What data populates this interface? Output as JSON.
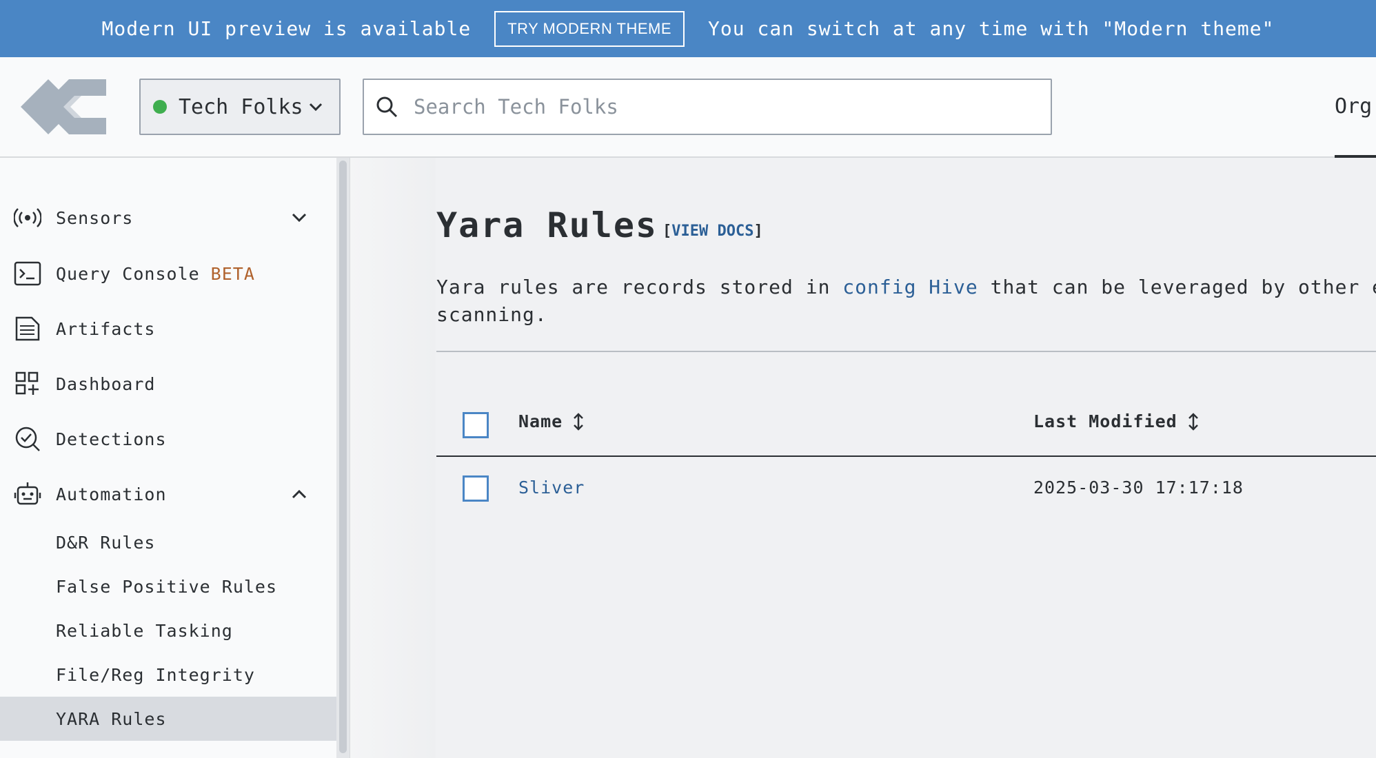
{
  "banner": {
    "message": "Modern UI preview is available",
    "button_label": "TRY MODERN THEME",
    "note": "You can switch at any time with \"Modern theme\""
  },
  "header": {
    "org_name": "Tech Folks",
    "org_status_color": "#3fae4f",
    "search_placeholder": "Search Tech Folks",
    "right_tab": "Org"
  },
  "sidebar": {
    "items": [
      {
        "label": "Sensors",
        "icon": "broadcast-icon",
        "expanded": false
      },
      {
        "label": "Query Console",
        "badge": "BETA",
        "icon": "terminal-icon"
      },
      {
        "label": "Artifacts",
        "icon": "document-icon"
      },
      {
        "label": "Dashboard",
        "icon": "dashboard-icon"
      },
      {
        "label": "Detections",
        "icon": "detections-icon"
      },
      {
        "label": "Automation",
        "icon": "robot-icon",
        "expanded": true
      }
    ],
    "automation_children": [
      {
        "label": "D&R Rules"
      },
      {
        "label": "False Positive Rules"
      },
      {
        "label": "Reliable Tasking"
      },
      {
        "label": "File/Reg Integrity"
      },
      {
        "label": "YARA Rules",
        "active": true
      }
    ]
  },
  "main": {
    "title": "Yara Rules",
    "docs_open": "[",
    "docs_link": "VIEW DOCS",
    "docs_close": "]",
    "desc_part1": "Yara rules are records stored in ",
    "desc_link": "config Hive",
    "desc_part2": " that can be leveraged by other ex\nscanning.",
    "table": {
      "col_name": "Name",
      "col_modified": "Last Modified",
      "rows": [
        {
          "name": "Sliver",
          "last_modified": "2025-03-30 17:17:18"
        }
      ]
    }
  },
  "colors": {
    "banner": "#4a86c5",
    "link": "#2b5f96",
    "beta": "#b0622d",
    "active_item": "#d8dbe0"
  }
}
